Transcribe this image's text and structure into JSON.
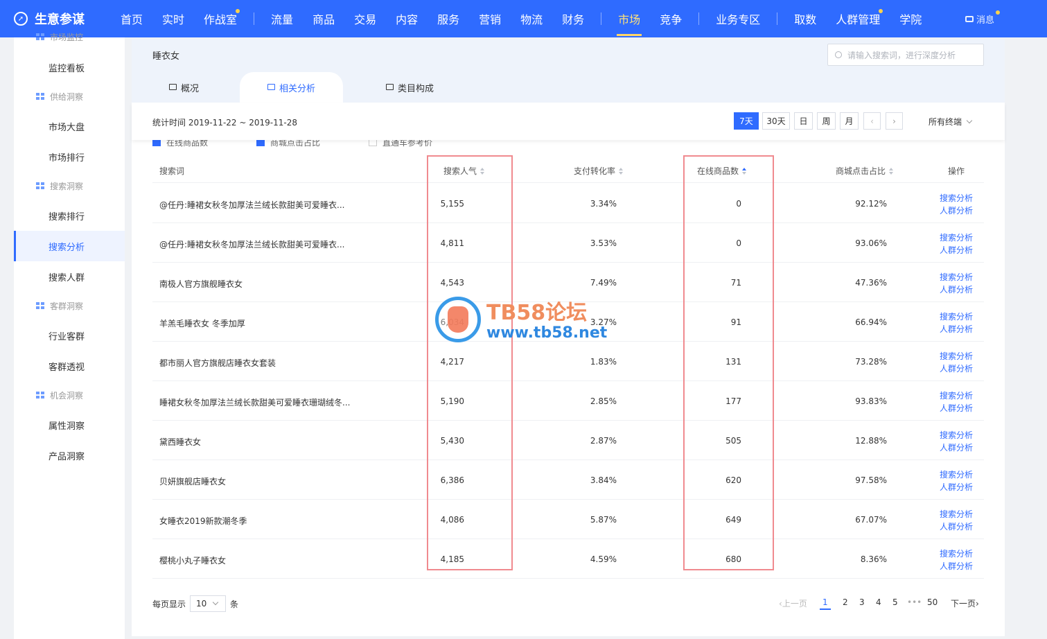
{
  "brand": {
    "title": "生意参谋"
  },
  "nav": {
    "items": [
      "首页",
      "实时",
      "作战室",
      "流量",
      "商品",
      "交易",
      "内容",
      "服务",
      "营销",
      "物流",
      "财务",
      "市场",
      "竞争",
      "业务专区",
      "取数",
      "人群管理",
      "学院"
    ],
    "message": "消息"
  },
  "sidebar": {
    "top_partial": "市场监控",
    "items": {
      "monitor_board": "监控看板",
      "supply_group": "供给洞察",
      "market_overview": "市场大盘",
      "market_rank": "市场排行",
      "search_group": "搜索洞察",
      "search_rank": "搜索排行",
      "search_analysis": "搜索分析",
      "search_crowd": "搜索人群",
      "customer_group": "客群洞察",
      "industry_customers": "行业客群",
      "customer_insight": "客群透视",
      "opportunity_group": "机会洞察",
      "attribute_insight": "属性洞察",
      "product_insight": "产品洞察"
    }
  },
  "header": {
    "keyword": "睡衣女",
    "search_placeholder": "请输入搜索词，进行深度分析",
    "tabs": [
      "概况",
      "相关分析",
      "类目构成"
    ]
  },
  "stats": {
    "time_label": "统计时间 2019-11-22 ~ 2019-11-28",
    "ranges": [
      "7天",
      "30天",
      "日",
      "周",
      "月"
    ],
    "terminal": "所有终端"
  },
  "checkboxes": [
    "在线商品数",
    "商城点击占比",
    "直通车参考价"
  ],
  "table": {
    "headers": [
      "搜索词",
      "搜索人气",
      "支付转化率",
      "在线商品数",
      "商城点击占比",
      "操作"
    ],
    "op_links": [
      "搜索分析",
      "人群分析"
    ],
    "rows": [
      [
        "@任丹:睡裙女秋冬加厚法兰绒长款甜美可爱睡衣...",
        "5,155",
        "3.34%",
        "0",
        "92.12%"
      ],
      [
        "@任丹:睡裙女秋冬加厚法兰绒长款甜美可爱睡衣...",
        "4,811",
        "3.53%",
        "0",
        "93.06%"
      ],
      [
        "南极人官方旗舰睡衣女",
        "4,543",
        "7.49%",
        "71",
        "47.36%"
      ],
      [
        "羊羔毛睡衣女 冬季加厚",
        "6,034",
        "3.27%",
        "91",
        "66.94%"
      ],
      [
        "都市丽人官方旗舰店睡衣女套装",
        "4,217",
        "1.83%",
        "131",
        "73.28%"
      ],
      [
        "睡裙女秋冬加厚法兰绒长款甜美可爱睡衣珊瑚绒冬...",
        "5,190",
        "2.85%",
        "177",
        "93.83%"
      ],
      [
        "黛西睡衣女",
        "5,430",
        "2.87%",
        "505",
        "12.88%"
      ],
      [
        "贝妍旗舰店睡衣女",
        "6,386",
        "3.84%",
        "620",
        "97.58%"
      ],
      [
        "女睡衣2019新款潮冬季",
        "4,086",
        "5.87%",
        "649",
        "67.07%"
      ],
      [
        "樱桃小丸子睡衣女",
        "4,185",
        "4.59%",
        "680",
        "8.36%"
      ]
    ]
  },
  "pagination": {
    "per_page_label": "每页显示",
    "per_page_value": "10",
    "per_page_unit": "条",
    "prev": "上一页",
    "pages": [
      "1",
      "2",
      "3",
      "4",
      "5"
    ],
    "ellipsis": "•••",
    "last_page": "50",
    "next": "下一页"
  },
  "watermark": {
    "line1": "TB58论坛",
    "line2": "www.tb58.net"
  },
  "colors": {
    "primary": "#2f6bff",
    "highlight_box": "#f08a8f"
  }
}
